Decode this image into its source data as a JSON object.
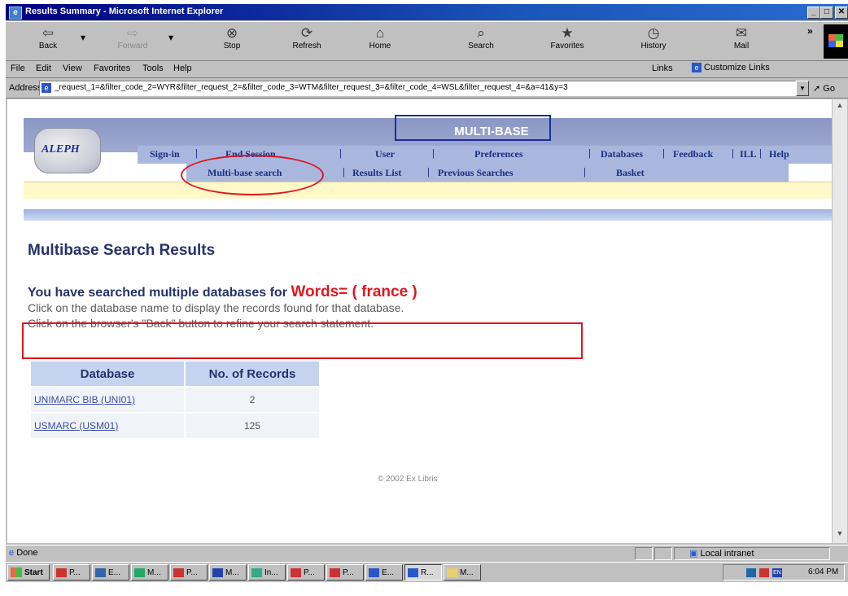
{
  "window": {
    "title": "Results Summary - Microsoft Internet Explorer",
    "min_glyph": "_",
    "max_glyph": "□",
    "close_glyph": "✕"
  },
  "toolbar": {
    "back": "Back",
    "forward": "Forward",
    "stop": "Stop",
    "refresh": "Refresh",
    "home": "Home",
    "search": "Search",
    "favorites": "Favorites",
    "history": "History",
    "mail": "Mail",
    "chevron": "»"
  },
  "menu": {
    "file": "File",
    "edit": "Edit",
    "view": "View",
    "favorites": "Favorites",
    "tools": "Tools",
    "help": "Help",
    "links": "Links",
    "customize_links": "Customize Links"
  },
  "address": {
    "label": "Address",
    "url": "_request_1=&filter_code_2=WYR&filter_request_2=&filter_code_3=WTM&filter_request_3=&filter_code_4=WSL&filter_request_4=&a=41&y=3",
    "go": "Go"
  },
  "aleph": {
    "logo_text": "ALEPH",
    "banner": "MULTI-BASE",
    "nav_row1": [
      "Sign-in",
      "End Session",
      "User",
      "Preferences",
      "Databases",
      "Feedback",
      "ILL",
      "Help"
    ],
    "nav_row2": [
      "Multi-base search",
      "Results List",
      "Previous Searches",
      "Basket"
    ],
    "separator": "|"
  },
  "content": {
    "page_title": "Multibase Search Results",
    "searched_prefix": "You have searched multiple databases for",
    "search_term": "Words= ( france )",
    "help_line_1": "Click on the database name to display the records found for that database.",
    "help_line_2": "Click on the browser's \"Back\" button to refine your search statement.",
    "table": {
      "headers": [
        "Database",
        "No. of Records"
      ],
      "rows": [
        {
          "database": "UNIMARC BIB (UNI01)",
          "records": "2"
        },
        {
          "database": "USMARC (USM01)",
          "records": "125"
        }
      ]
    },
    "copyright": "© 2002 Ex Libris"
  },
  "status": {
    "text": "Done",
    "zone": "Local intranet"
  },
  "taskbar": {
    "start": "Start",
    "buttons": [
      "P...",
      "E...",
      "M...",
      "P...",
      "M...",
      "In...",
      "P...",
      "P...",
      "E...",
      "R...",
      "M..."
    ],
    "clock": "6:04 PM"
  },
  "annotations": {
    "highlight_color": "#e0161f",
    "banner_box_color": "#1b2c9c"
  }
}
